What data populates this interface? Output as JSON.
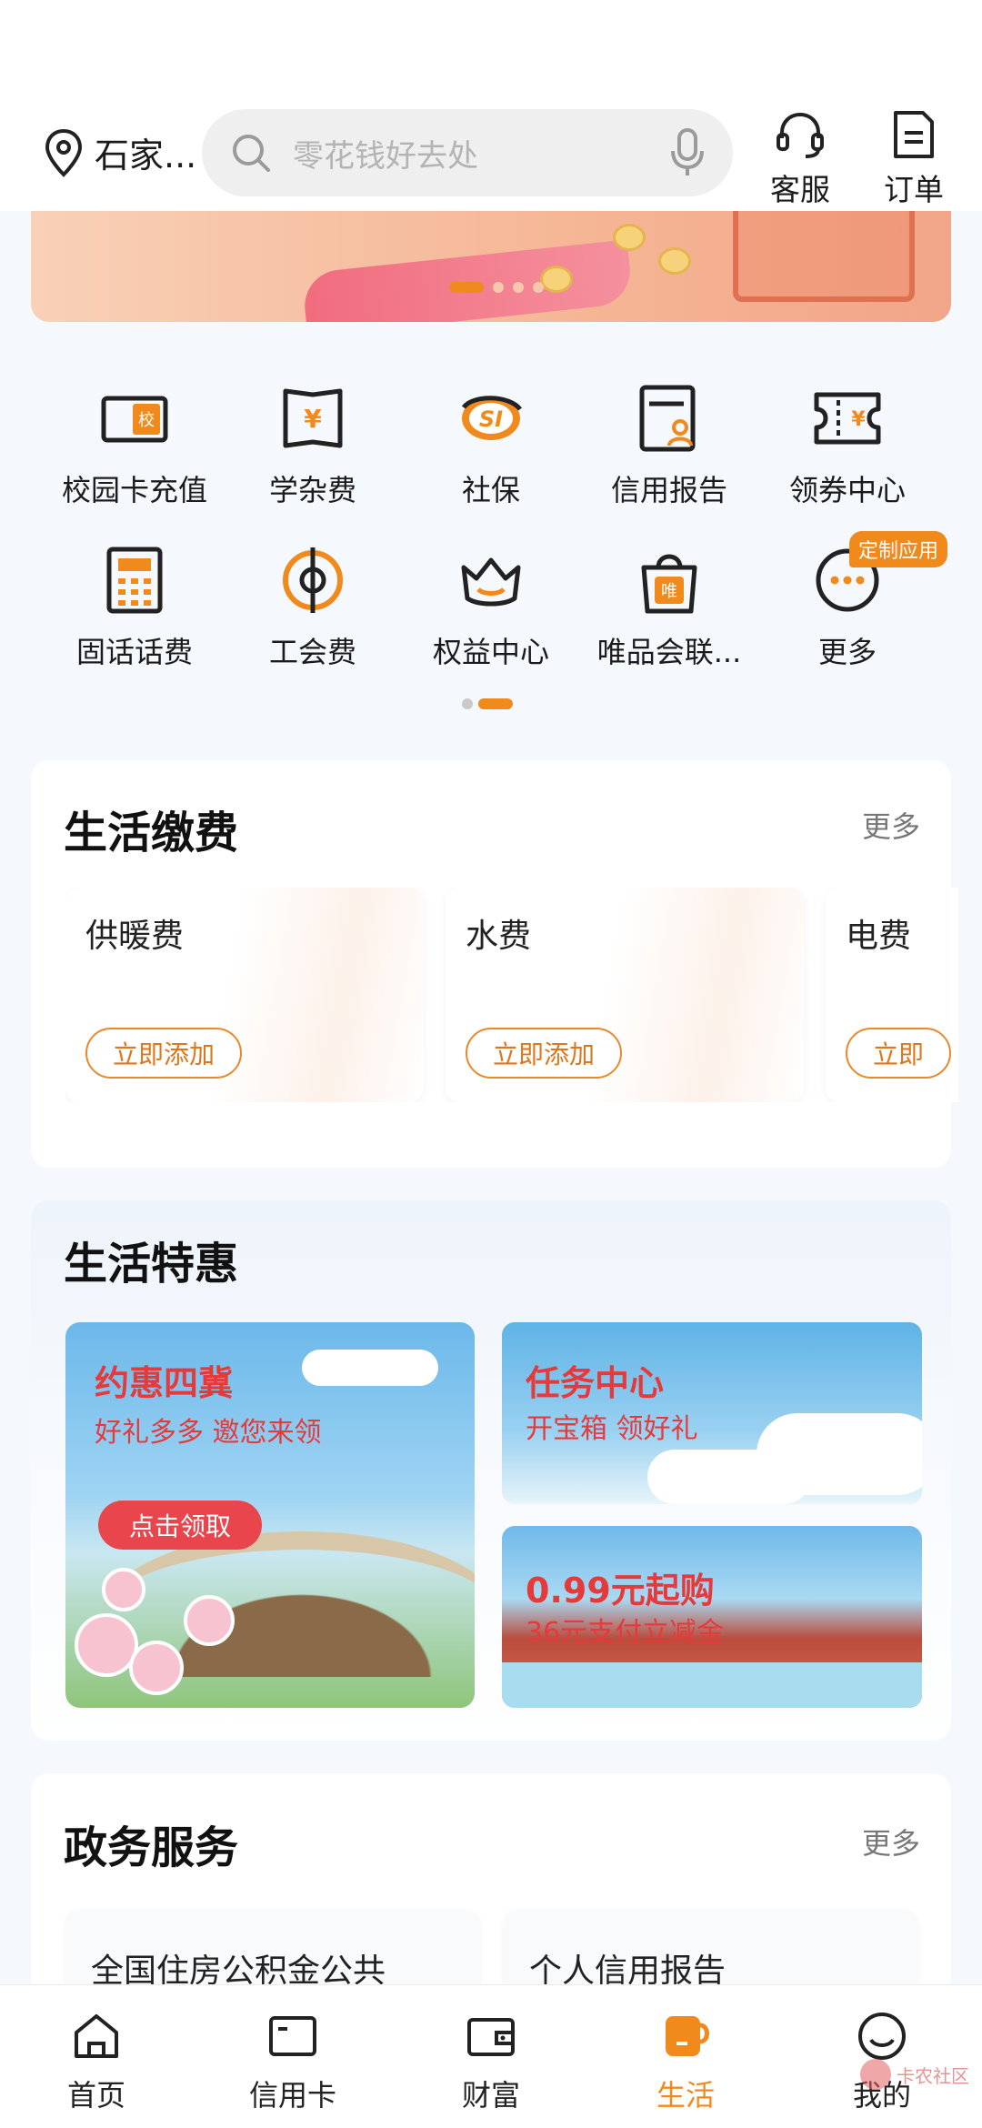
{
  "header": {
    "location": "石家...",
    "search_placeholder": "零花钱好去处",
    "service_label": "客服",
    "order_label": "订单"
  },
  "grid": {
    "row1": [
      {
        "label": "校园卡充值",
        "icon": "campus-card-icon"
      },
      {
        "label": "学杂费",
        "icon": "tuition-icon"
      },
      {
        "label": "社保",
        "icon": "social-security-icon"
      },
      {
        "label": "信用报告",
        "icon": "credit-report-icon"
      },
      {
        "label": "领券中心",
        "icon": "coupon-icon"
      }
    ],
    "row2": [
      {
        "label": "固话话费",
        "icon": "landline-icon"
      },
      {
        "label": "工会费",
        "icon": "union-fee-icon"
      },
      {
        "label": "权益中心",
        "icon": "crown-icon"
      },
      {
        "label": "唯品会联...",
        "icon": "vip-bag-icon"
      },
      {
        "label": "更多",
        "icon": "more-icon"
      }
    ],
    "badge": "定制应用"
  },
  "life_payment": {
    "title": "生活缴费",
    "more": "更多",
    "items": [
      {
        "name": "供暖费",
        "button": "立即添加"
      },
      {
        "name": "水费",
        "button": "立即添加"
      },
      {
        "name": "电费",
        "button": "立即"
      }
    ]
  },
  "deals": {
    "title": "生活特惠",
    "big": {
      "title": "约惠四冀",
      "subtitle": "好礼多多 邀您来领",
      "button": "点击领取"
    },
    "task": {
      "title": "任务中心",
      "subtitle": "开宝箱 领好礼"
    },
    "promo": {
      "title": "0.99元起购",
      "subtitle": "36元支付立减金"
    }
  },
  "gov": {
    "title": "政务服务",
    "more": "更多",
    "items": [
      "全国住房公积金公共",
      "个人信用报告"
    ]
  },
  "nav": {
    "items": [
      "首页",
      "信用卡",
      "财富",
      "生活",
      "我的"
    ],
    "active_color": "#f08a1c"
  },
  "watermark": "卡农社区",
  "colors": {
    "accent": "#f08a1c",
    "promo_red": "#e63a3a"
  }
}
